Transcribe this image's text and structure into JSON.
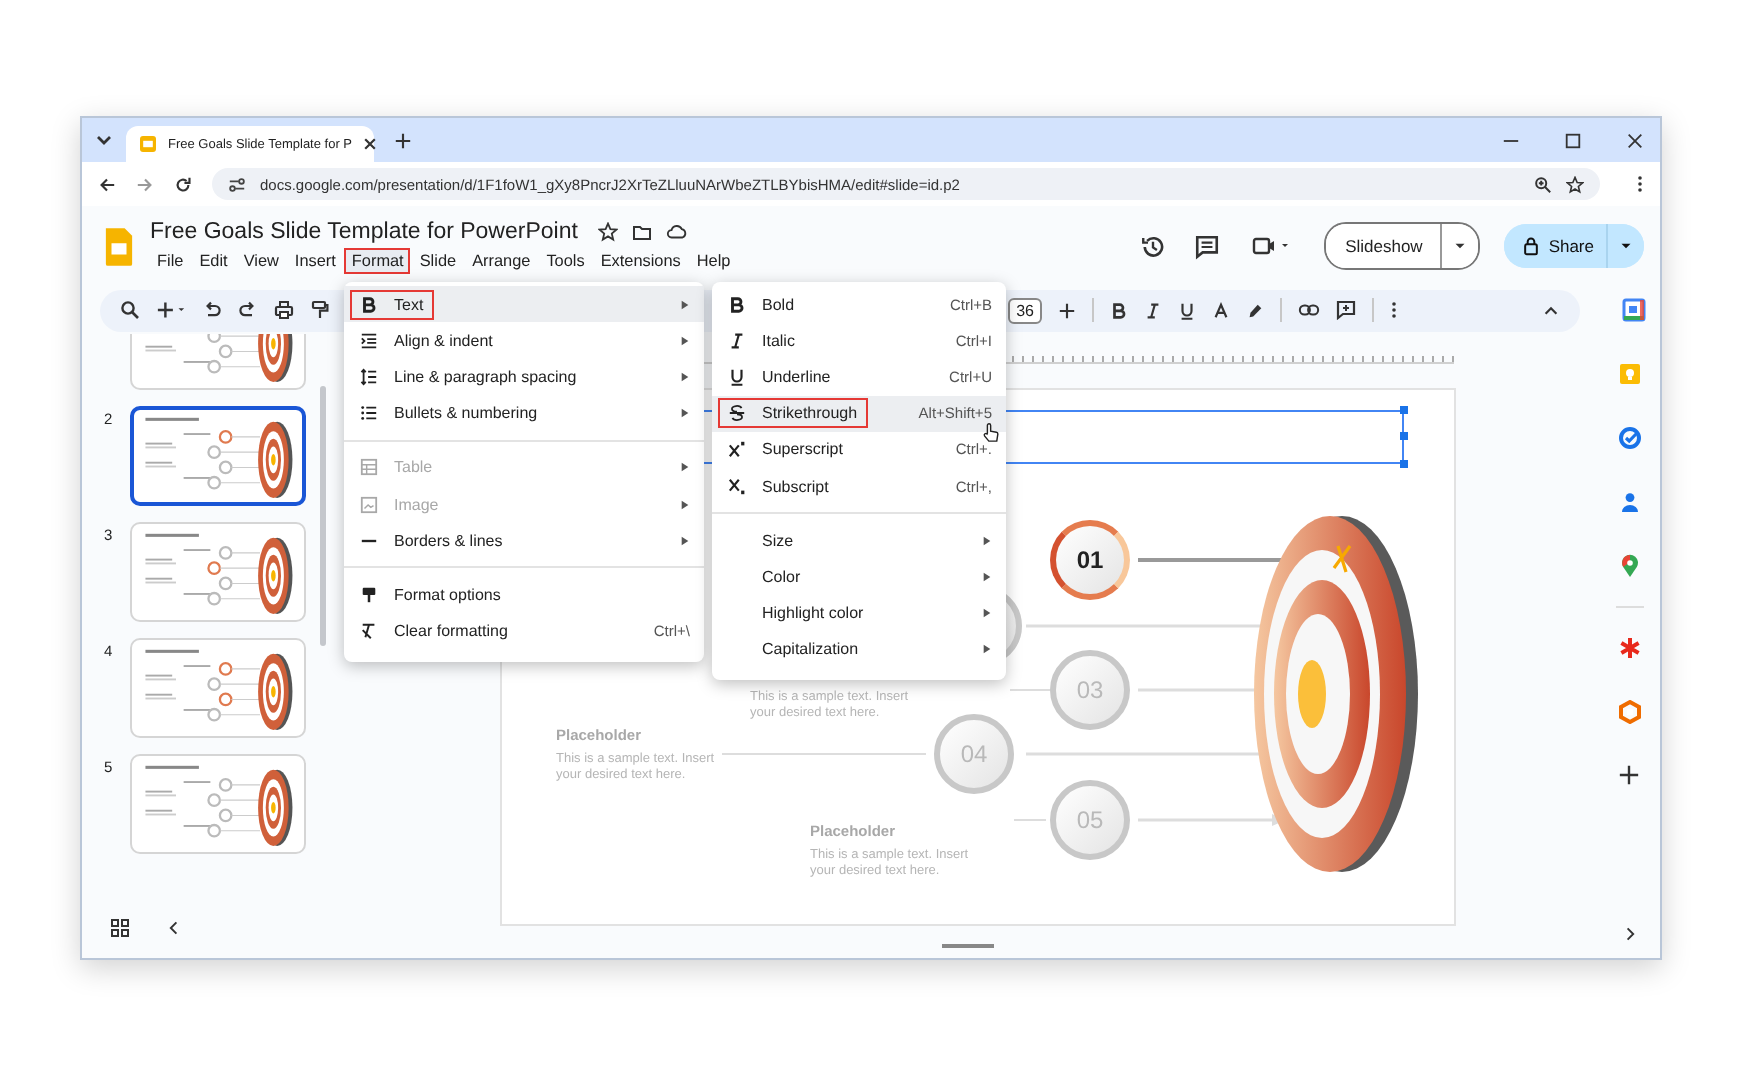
{
  "browser": {
    "tab_title": "Free Goals Slide Template for P",
    "url": "docs.google.com/presentation/d/1F1foW1_gXy8PncrJ2XrTeZLluuNArWbeZTLBYbisHMA/edit#slide=id.p2"
  },
  "document": {
    "title": "Free Goals Slide Template for PowerPoint"
  },
  "menu_bar": [
    {
      "label": "File",
      "selected": false
    },
    {
      "label": "Edit",
      "selected": false
    },
    {
      "label": "View",
      "selected": false
    },
    {
      "label": "Insert",
      "selected": false
    },
    {
      "label": "Format",
      "selected": true
    },
    {
      "label": "Slide",
      "selected": false
    },
    {
      "label": "Arrange",
      "selected": false
    },
    {
      "label": "Tools",
      "selected": false
    },
    {
      "label": "Extensions",
      "selected": false
    },
    {
      "label": "Help",
      "selected": false
    }
  ],
  "actions": {
    "slideshow": "Slideshow",
    "share": "Share"
  },
  "toolbar": {
    "font_size": "36"
  },
  "format_menu": {
    "groups": [
      [
        {
          "label": "Text",
          "submenu": true,
          "disabled": false,
          "selected": true
        },
        {
          "label": "Align & indent",
          "submenu": true,
          "disabled": false,
          "selected": false
        },
        {
          "label": "Line & paragraph spacing",
          "submenu": true,
          "disabled": false,
          "selected": false
        },
        {
          "label": "Bullets & numbering",
          "submenu": true,
          "disabled": false,
          "selected": false
        }
      ],
      [
        {
          "label": "Table",
          "submenu": true,
          "disabled": true,
          "selected": false
        },
        {
          "label": "Image",
          "submenu": true,
          "disabled": true,
          "selected": false
        },
        {
          "label": "Borders & lines",
          "submenu": true,
          "disabled": false,
          "selected": false
        }
      ],
      [
        {
          "label": "Format options",
          "submenu": false,
          "disabled": false,
          "selected": false
        },
        {
          "label": "Clear formatting",
          "shortcut": "Ctrl+\\",
          "submenu": false,
          "disabled": false,
          "selected": false
        }
      ]
    ]
  },
  "text_submenu": {
    "groups": [
      [
        {
          "label": "Bold",
          "shortcut": "Ctrl+B",
          "submenu": false,
          "selected": false
        },
        {
          "label": "Italic",
          "shortcut": "Ctrl+I",
          "submenu": false,
          "selected": false
        },
        {
          "label": "Underline",
          "shortcut": "Ctrl+U",
          "submenu": false,
          "selected": false
        },
        {
          "label": "Strikethrough",
          "shortcut": "Alt+Shift+5",
          "submenu": false,
          "selected": true
        },
        {
          "label": "Superscript",
          "shortcut": "Ctrl+.",
          "submenu": false,
          "selected": false
        },
        {
          "label": "Subscript",
          "shortcut": "Ctrl+,",
          "submenu": false,
          "selected": false
        }
      ],
      [
        {
          "label": "Size",
          "submenu": true,
          "selected": false
        },
        {
          "label": "Color",
          "submenu": true,
          "selected": false
        },
        {
          "label": "Highlight color",
          "submenu": true,
          "selected": false
        },
        {
          "label": "Capitalization",
          "submenu": true,
          "selected": false
        }
      ]
    ]
  },
  "filmstrip": [
    {
      "selected": false
    },
    {
      "number": "2",
      "selected": true
    },
    {
      "number": "3",
      "selected": false
    },
    {
      "number": "4",
      "selected": false
    },
    {
      "number": "5",
      "selected": false
    }
  ],
  "slide": {
    "markers": [
      {
        "label": "01",
        "selected": true
      },
      {
        "selected": false
      },
      {
        "label": "03",
        "selected": false
      },
      {
        "label": "04",
        "selected": false
      },
      {
        "label": "05",
        "selected": false
      }
    ],
    "placeholders": [
      {
        "text": "This is a sample text. Insert your desired text here."
      },
      {
        "title": "Placeholder",
        "text": "This is a sample text. Insert your desired text here."
      },
      {
        "title": "Placeholder",
        "text": "This is a sample text. Insert your desired text here."
      }
    ]
  }
}
